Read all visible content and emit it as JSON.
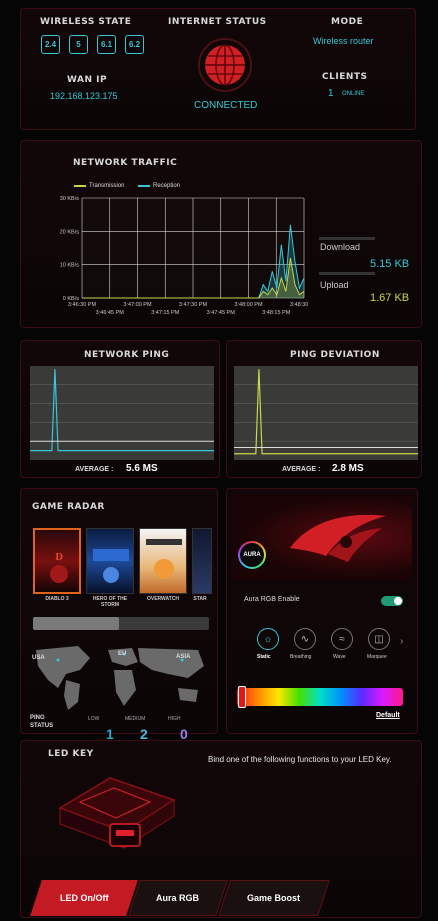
{
  "status": {
    "wireless_state_label": "WIRELESS STATE",
    "bands": [
      "2.4",
      "5",
      "6.1",
      "6.2"
    ],
    "internet_status_label": "INTERNET STATUS",
    "connection_state": "CONNECTED",
    "mode_label": "MODE",
    "mode_value": "Wireless router",
    "wan_ip_label": "WAN IP",
    "wan_ip_value": "192.168.123.175",
    "clients_label": "CLIENTS",
    "clients_count": "1",
    "clients_suffix": "ONLINE"
  },
  "traffic": {
    "title": "NETWORK TRAFFIC",
    "download_label": "Download",
    "download_value": "5.15 KB",
    "upload_label": "Upload",
    "upload_value": "1.67 KB",
    "colors": {
      "transmission": "#c9d64a",
      "reception": "#39c6d6"
    }
  },
  "chart_data": [
    {
      "type": "line",
      "title": "NETWORK TRAFFIC",
      "legend": "top",
      "series": [
        {
          "name": "Transmission",
          "values": [
            0,
            0,
            0,
            0,
            0,
            0,
            0,
            0,
            0,
            0,
            0,
            0,
            0,
            0,
            0,
            0,
            0,
            0,
            0,
            0,
            0,
            0,
            0,
            0,
            0,
            0,
            0,
            0,
            0,
            0,
            0,
            0,
            0,
            0,
            0,
            0,
            0,
            0,
            0,
            0,
            2,
            1,
            3,
            1,
            6,
            2,
            12,
            4,
            1,
            2
          ]
        },
        {
          "name": "Reception",
          "values": [
            0,
            0,
            0,
            0,
            0,
            0,
            0,
            0,
            0,
            0,
            0,
            0,
            0,
            0,
            0,
            0,
            0,
            0,
            0,
            0,
            0,
            0,
            0,
            0,
            0,
            0,
            0,
            0,
            0,
            0,
            0,
            0,
            0,
            0,
            0,
            0,
            0,
            0,
            0,
            0,
            4,
            2,
            8,
            3,
            16,
            5,
            22,
            11,
            3,
            6
          ]
        }
      ],
      "y_ticks": [
        "0 KB/s",
        "10 KB/s",
        "20 KB/s",
        "30 KB/s"
      ],
      "ylim": [
        0,
        30
      ],
      "x_ticks_top": [
        "3:46:30 PM",
        "3:47:00 PM",
        "3:47:30 PM",
        "3:48:00 PM",
        "3:48:30 PM"
      ],
      "x_ticks_bottom": [
        "3:46:45 PM",
        "3:47:15 PM",
        "3:47:45 PM",
        "3:48:15 PM"
      ],
      "grid": true
    },
    {
      "type": "line",
      "title": "NETWORK PING",
      "series": [
        {
          "values": [
            3,
            3,
            3,
            3,
            3,
            3,
            3,
            3,
            3,
            3,
            3,
            3,
            3,
            3,
            3,
            3,
            3,
            3,
            3,
            3,
            3,
            3,
            3,
            3,
            3,
            3,
            3,
            3,
            3,
            3,
            3,
            3,
            3,
            3,
            3,
            3,
            3,
            3,
            3,
            3,
            3,
            3,
            3,
            3,
            3,
            3,
            3,
            3,
            3,
            3,
            3,
            3,
            3,
            3,
            3,
            3,
            3,
            3,
            3,
            3
          ]
        }
      ],
      "average_label": "AVERAGE :",
      "average_value": "5.6 MS",
      "grid": true
    },
    {
      "type": "line",
      "title": "PING DEVIATION",
      "series": [
        {
          "values": [
            2,
            2,
            2,
            2,
            2,
            2,
            2,
            2,
            2,
            2,
            2,
            2,
            2,
            2,
            2,
            2,
            2,
            2,
            2,
            2,
            2,
            2,
            2,
            2,
            2,
            2,
            2,
            2,
            2,
            2,
            2,
            2,
            2,
            2,
            2,
            2,
            2,
            2,
            2,
            2,
            2,
            2,
            2,
            2,
            2,
            2,
            2,
            2,
            2,
            2,
            2,
            2,
            2,
            2,
            2,
            2,
            2,
            2,
            2,
            2
          ]
        }
      ],
      "average_label": "AVERAGE :",
      "average_value": "2.8 MS",
      "grid": true
    }
  ],
  "radar": {
    "title": "GAME RADAR",
    "games": [
      "DIABLO 3",
      "HERO OF THE STORM",
      "OVERWATCH",
      "STAR"
    ],
    "ping_status_label": "PING STATUS",
    "levels": [
      "LOW",
      "MEDIUM",
      "HIGH"
    ],
    "counts": [
      "1",
      "2",
      "0"
    ],
    "map_labels": [
      "USA",
      "EU",
      "ASIA"
    ]
  },
  "aura": {
    "logo_text": "AURA",
    "enable_label": "Aura RGB Enable",
    "modes": [
      "Static",
      "Breathing",
      "Wave",
      "Marquee"
    ],
    "default_label": "Default"
  },
  "led": {
    "title": "LED KEY",
    "description": "Bind one of the following functions to your LED Key.",
    "buttons": [
      "LED On/Off",
      "Aura RGB",
      "Game Boost"
    ]
  }
}
